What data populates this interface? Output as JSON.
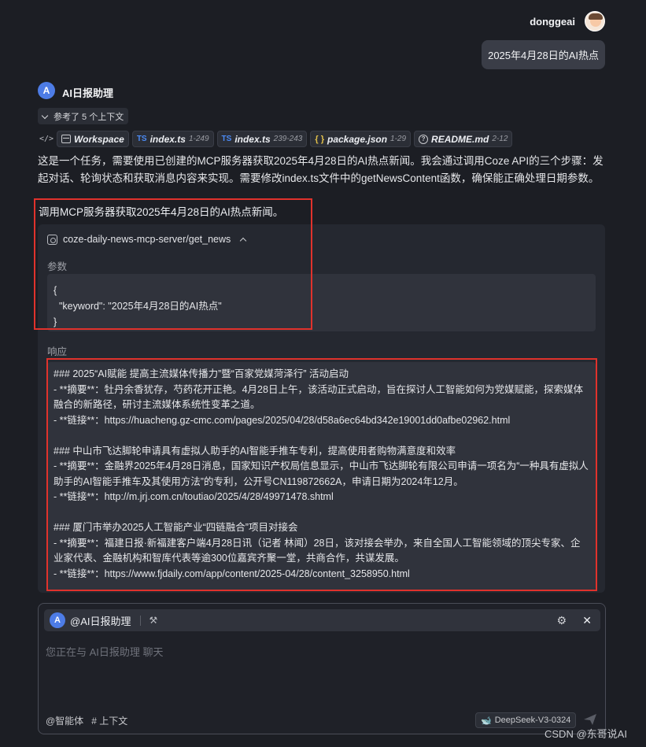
{
  "user": {
    "name": "donggeai",
    "message": "2025年4月28日的AI热点"
  },
  "assistant": {
    "avatar_letter": "A",
    "name": "AI日报助理",
    "ref_toggle": "参考了 5 个上下文",
    "files": [
      {
        "label": "Workspace",
        "range": ""
      },
      {
        "badge": "TS",
        "label": "index.ts",
        "range": "1-249"
      },
      {
        "badge": "TS",
        "label": "index.ts",
        "range": "239-243"
      },
      {
        "badge": "{ }",
        "label": "package.json",
        "range": "1-29"
      },
      {
        "label": "README.md",
        "range": "2-12"
      }
    ],
    "paragraph": "这是一个任务，需要使用已创建的MCP服务器获取2025年4月28日的AI热点新闻。我会通过调用Coze API的三个步骤：发起对话、轮询状态和获取消息内容来实现。需要修改index.ts文件中的getNewsContent函数，确保能正确处理日期参数。",
    "call_line": "调用MCP服务器获取2025年4月28日的AI热点新闻。"
  },
  "tool": {
    "name": "coze-daily-news-mcp-server/get_news",
    "params_label": "参数",
    "params_json": "{\n  \"keyword\": \"2025年4月28日的AI热点\"\n}",
    "response_label": "响应",
    "response_blocks": [
      [
        "### 2025“AI赋能 提高主流媒体传播力”暨“百家党媒菏泽行” 活动启动",
        "- **摘要**：牡丹余香犹存，芍药花开正艳。4月28日上午，该活动正式启动，旨在探讨人工智能如何为党媒赋能，探索媒体融合的新路径，研讨主流媒体系统性变革之道。",
        "- **链接**：https://huacheng.gz-cmc.com/pages/2025/04/28/d58a6ec64bd342e19001dd0afbe02962.html"
      ],
      [
        "### 中山市飞达脚轮申请具有虚拟人助手的AI智能手推车专利，提高使用者购物满意度和效率",
        "- **摘要**：金融界2025年4月28日消息，国家知识产权局信息显示，中山市飞达脚轮有限公司申请一项名为“一种具有虚拟人助手的AI智能手推车及其使用方法”的专利，公开号CN119872662A，申请日期为2024年12月。",
        "- **链接**：http://m.jrj.com.cn/toutiao/2025/4/28/49971478.shtml"
      ],
      [
        "### 厦门市举办2025人工智能产业“四链融合”项目对接会",
        "- **摘要**：福建日报·新福建客户端4月28日讯（记者 林闻）28日，该对接会举办，来自全国人工智能领域的顶尖专家、企业家代表、金融机构和智库代表等逾300位嘉宾齐聚一堂，共商合作，共谋发展。",
        "- **链接**：https://www.fjdaily.com/app/content/2025-04/28/content_3258950.html"
      ]
    ]
  },
  "composer": {
    "agent_label": "@AI日报助理",
    "placeholder": "您正在与 AI日报助理 聊天",
    "agent_tool": "@智能体",
    "context_tool": "# 上下文",
    "model": "DeepSeek-V3-0324"
  },
  "watermark": "CSDN @东哥说AI",
  "colors": {
    "background": "#1c1e24",
    "card": "#252830",
    "highlight": "#e0322c",
    "accent": "#4d7ce6"
  }
}
